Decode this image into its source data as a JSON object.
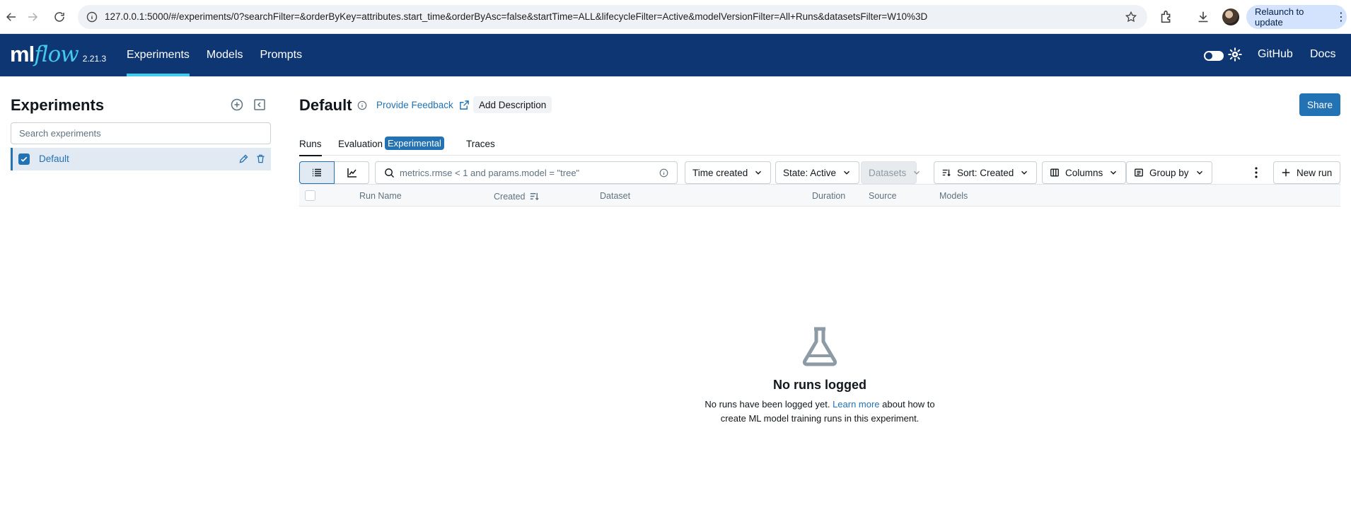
{
  "browser": {
    "url": "127.0.0.1:5000/#/experiments/0?searchFilter=&orderByKey=attributes.start_time&orderByAsc=false&startTime=ALL&lifecycleFilter=Active&modelVersionFilter=All+Runs&datasetsFilter=W10%3D",
    "relaunch_label": "Relaunch to update",
    "menu_dots": "⋮"
  },
  "header": {
    "logo_ml": "ml",
    "logo_flow": "flow",
    "version": "2.21.3",
    "nav": [
      "Experiments",
      "Models",
      "Prompts"
    ],
    "github": "GitHub",
    "docs": "Docs"
  },
  "sidebar": {
    "title": "Experiments",
    "search_placeholder": "Search experiments",
    "experiments": [
      {
        "name": "Default",
        "selected": true
      }
    ]
  },
  "main": {
    "title": "Default",
    "feedback": "Provide Feedback",
    "add_description": "Add Description",
    "share": "Share",
    "tabs": {
      "runs": "Runs",
      "evaluation": "Evaluation",
      "experimental_badge": "Experimental",
      "traces": "Traces"
    },
    "toolbar": {
      "search_placeholder": "metrics.rmse < 1 and params.model = \"tree\"",
      "time_created": "Time created",
      "state": "State: Active",
      "datasets": "Datasets",
      "sort": "Sort: Created",
      "columns": "Columns",
      "group_by": "Group by",
      "new_run": "New run"
    },
    "columns": [
      "Run Name",
      "Created",
      "Dataset",
      "Duration",
      "Source",
      "Models"
    ],
    "empty": {
      "title": "No runs logged",
      "desc_before": "No runs have been logged yet.",
      "link": "Learn more",
      "desc_after": "about how to create ML model training runs in this experiment."
    }
  },
  "colors": {
    "header_bg": "#0e3672",
    "accent": "#2272b4",
    "nav_underline": "#43c9ed"
  }
}
